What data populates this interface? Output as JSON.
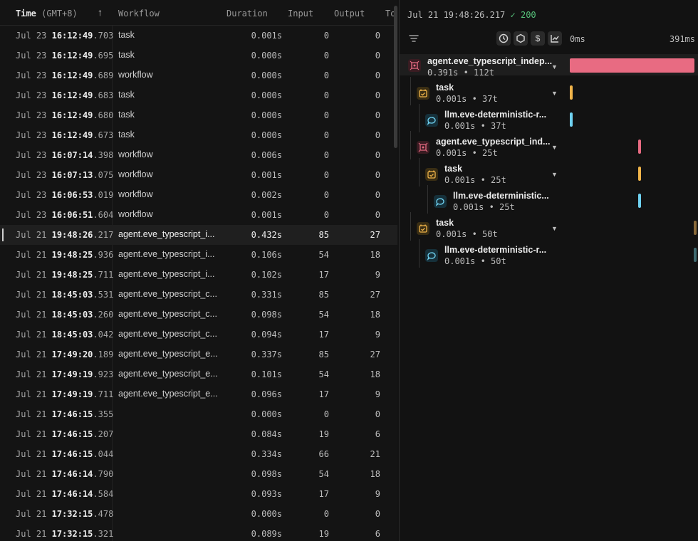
{
  "table": {
    "headers": {
      "time": "Time",
      "tz": "(GMT+8)",
      "workflow": "Workflow",
      "duration": "Duration",
      "input": "Input",
      "output": "Output",
      "total": "To"
    },
    "rows": [
      {
        "date": "Jul 23",
        "time": "16:12:49",
        "ms": ".703",
        "workflow": "task",
        "duration": "0.001s",
        "input": "0",
        "output": "0"
      },
      {
        "date": "Jul 23",
        "time": "16:12:49",
        "ms": ".695",
        "workflow": "task",
        "duration": "0.000s",
        "input": "0",
        "output": "0"
      },
      {
        "date": "Jul 23",
        "time": "16:12:49",
        "ms": ".689",
        "workflow": "workflow",
        "duration": "0.000s",
        "input": "0",
        "output": "0"
      },
      {
        "date": "Jul 23",
        "time": "16:12:49",
        "ms": ".683",
        "workflow": "task",
        "duration": "0.000s",
        "input": "0",
        "output": "0"
      },
      {
        "date": "Jul 23",
        "time": "16:12:49",
        "ms": ".680",
        "workflow": "task",
        "duration": "0.000s",
        "input": "0",
        "output": "0"
      },
      {
        "date": "Jul 23",
        "time": "16:12:49",
        "ms": ".673",
        "workflow": "task",
        "duration": "0.000s",
        "input": "0",
        "output": "0"
      },
      {
        "date": "Jul 23",
        "time": "16:07:14",
        "ms": ".398",
        "workflow": "workflow",
        "duration": "0.006s",
        "input": "0",
        "output": "0"
      },
      {
        "date": "Jul 23",
        "time": "16:07:13",
        "ms": ".075",
        "workflow": "workflow",
        "duration": "0.001s",
        "input": "0",
        "output": "0"
      },
      {
        "date": "Jul 23",
        "time": "16:06:53",
        "ms": ".019",
        "workflow": "workflow",
        "duration": "0.002s",
        "input": "0",
        "output": "0"
      },
      {
        "date": "Jul 23",
        "time": "16:06:51",
        "ms": ".604",
        "workflow": "workflow",
        "duration": "0.001s",
        "input": "0",
        "output": "0"
      },
      {
        "date": "Jul 21",
        "time": "19:48:26",
        "ms": ".217",
        "workflow": "agent.eve_typescript_i...",
        "duration": "0.432s",
        "input": "85",
        "output": "27",
        "selected": true
      },
      {
        "date": "Jul 21",
        "time": "19:48:25",
        "ms": ".936",
        "workflow": "agent.eve_typescript_i...",
        "duration": "0.106s",
        "input": "54",
        "output": "18"
      },
      {
        "date": "Jul 21",
        "time": "19:48:25",
        "ms": ".711",
        "workflow": "agent.eve_typescript_i...",
        "duration": "0.102s",
        "input": "17",
        "output": "9"
      },
      {
        "date": "Jul 21",
        "time": "18:45:03",
        "ms": ".531",
        "workflow": "agent.eve_typescript_c...",
        "duration": "0.331s",
        "input": "85",
        "output": "27"
      },
      {
        "date": "Jul 21",
        "time": "18:45:03",
        "ms": ".260",
        "workflow": "agent.eve_typescript_c...",
        "duration": "0.098s",
        "input": "54",
        "output": "18"
      },
      {
        "date": "Jul 21",
        "time": "18:45:03",
        "ms": ".042",
        "workflow": "agent.eve_typescript_c...",
        "duration": "0.094s",
        "input": "17",
        "output": "9"
      },
      {
        "date": "Jul 21",
        "time": "17:49:20",
        "ms": ".189",
        "workflow": "agent.eve_typescript_e...",
        "duration": "0.337s",
        "input": "85",
        "output": "27"
      },
      {
        "date": "Jul 21",
        "time": "17:49:19",
        "ms": ".923",
        "workflow": "agent.eve_typescript_e...",
        "duration": "0.101s",
        "input": "54",
        "output": "18"
      },
      {
        "date": "Jul 21",
        "time": "17:49:19",
        "ms": ".711",
        "workflow": "agent.eve_typescript_e...",
        "duration": "0.096s",
        "input": "17",
        "output": "9"
      },
      {
        "date": "Jul 21",
        "time": "17:46:15",
        "ms": ".355",
        "workflow": "",
        "duration": "0.000s",
        "input": "0",
        "output": "0"
      },
      {
        "date": "Jul 21",
        "time": "17:46:15",
        "ms": ".207",
        "workflow": "",
        "duration": "0.084s",
        "input": "19",
        "output": "6"
      },
      {
        "date": "Jul 21",
        "time": "17:46:15",
        "ms": ".044",
        "workflow": "",
        "duration": "0.334s",
        "input": "66",
        "output": "21"
      },
      {
        "date": "Jul 21",
        "time": "17:46:14",
        "ms": ".790",
        "workflow": "",
        "duration": "0.098s",
        "input": "54",
        "output": "18"
      },
      {
        "date": "Jul 21",
        "time": "17:46:14",
        "ms": ".584",
        "workflow": "",
        "duration": "0.093s",
        "input": "17",
        "output": "9"
      },
      {
        "date": "Jul 21",
        "time": "17:32:15",
        "ms": ".478",
        "workflow": "",
        "duration": "0.000s",
        "input": "0",
        "output": "0"
      },
      {
        "date": "Jul 21",
        "time": "17:32:15",
        "ms": ".321",
        "workflow": "",
        "duration": "0.089s",
        "input": "19",
        "output": "6"
      }
    ]
  },
  "trace": {
    "title_time": "Jul 21 19:48:26.217",
    "status_check": "✓",
    "status_code": "200",
    "toolbar": {
      "buttons": [
        "clock-icon",
        "hexagon-icon",
        "dollar-icon",
        "chart-icon"
      ],
      "dollar_label": "$"
    },
    "scale_start": "0ms",
    "scale_end": "391ms",
    "spans": [
      {
        "kind": "agent",
        "name": "agent.eve_typescript_indep...",
        "meta": "0.391s • 112t",
        "depth": 0,
        "bar_start": 0.0,
        "bar_end": 1.0,
        "color": "#e86b82",
        "collapsible": true
      },
      {
        "kind": "task",
        "name": "task",
        "meta": "0.001s • 37t",
        "depth": 1,
        "bar_start": 0.0,
        "bar_end": 0.02,
        "color": "#f0b44a",
        "collapsible": true
      },
      {
        "kind": "llm",
        "name": "llm.eve-deterministic-r...",
        "meta": "0.001s • 37t",
        "depth": 2,
        "bar_start": 0.0,
        "bar_end": 0.02,
        "color": "#6fd1f0",
        "collapsible": false
      },
      {
        "kind": "agent",
        "name": "agent.eve_typescript_ind...",
        "meta": "0.001s • 25t",
        "depth": 1,
        "bar_start": 0.55,
        "bar_end": 0.57,
        "color": "#e86b82",
        "collapsible": true
      },
      {
        "kind": "task",
        "name": "task",
        "meta": "0.001s • 25t",
        "depth": 2,
        "bar_start": 0.55,
        "bar_end": 0.57,
        "color": "#f0b44a",
        "collapsible": true
      },
      {
        "kind": "llm",
        "name": "llm.eve-deterministic...",
        "meta": "0.001s • 25t",
        "depth": 3,
        "bar_start": 0.55,
        "bar_end": 0.57,
        "color": "#6fd1f0",
        "collapsible": false
      },
      {
        "kind": "task",
        "name": "task",
        "meta": "0.001s • 50t",
        "depth": 1,
        "bar_start": 0.995,
        "bar_end": 1.0,
        "color": "#8a6a3a",
        "collapsible": true
      },
      {
        "kind": "llm",
        "name": "llm.eve-deterministic-r...",
        "meta": "0.001s • 50t",
        "depth": 2,
        "bar_start": 0.995,
        "bar_end": 1.0,
        "color": "#3f6a70",
        "collapsible": false
      }
    ]
  }
}
